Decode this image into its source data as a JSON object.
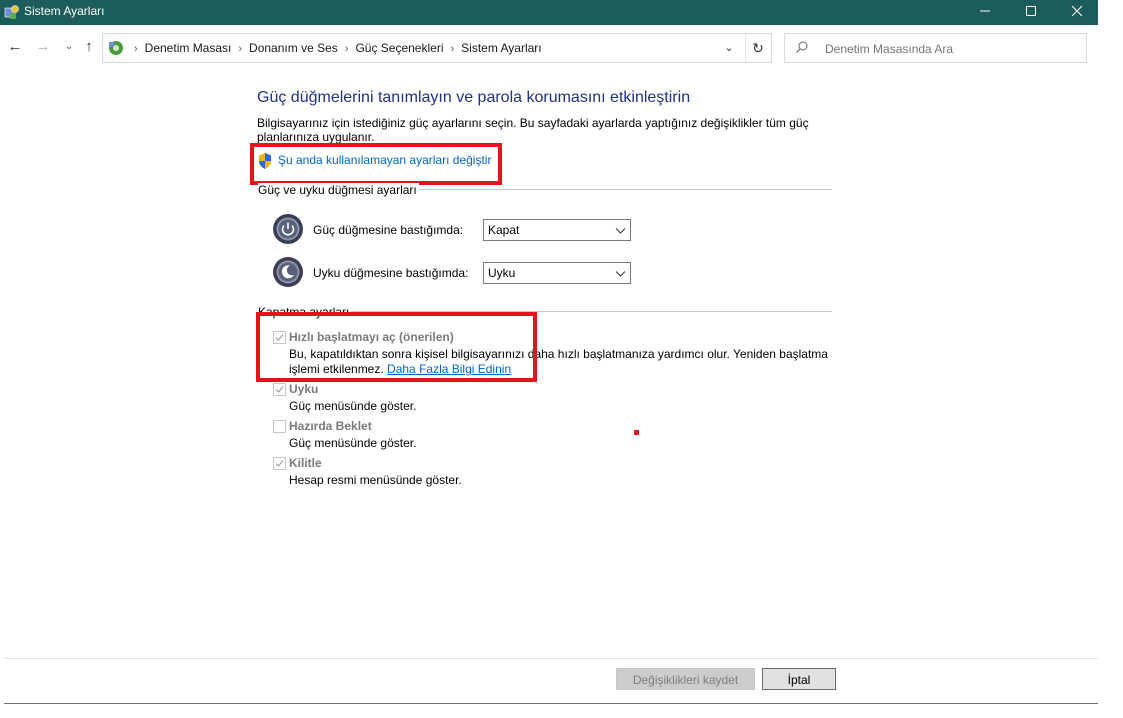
{
  "window": {
    "title": "Sistem Ayarları",
    "controls": [
      "minimize-icon",
      "maximize-icon",
      "close-icon"
    ]
  },
  "address_bar": {
    "breadcrumbs": [
      "Denetim Masası",
      "Donanım ve Ses",
      "Güç Seçenekleri",
      "Sistem Ayarları"
    ]
  },
  "search": {
    "placeholder": "Denetim Masasında Ara"
  },
  "main": {
    "title": "Güç düğmelerini tanımlayın ve parola korumasını etkinleştirin",
    "description": "Bilgisayarınız için istediğiniz güç ayarlarını seçin. Bu sayfadaki ayarlarda yaptığınız değişiklikler tüm güç planlarınıza uygulanır.",
    "change_settings_link": "Şu anda kullanılamayan ayarları değiştir",
    "power_group": {
      "header": "Güç ve uyku düğmesi ayarları",
      "rows": [
        {
          "label": "Güç düğmesine bastığımda:",
          "value": "Kapat",
          "icon": "power-button-icon"
        },
        {
          "label": "Uyku düğmesine bastığımda:",
          "value": "Uyku",
          "icon": "sleep-button-icon"
        }
      ]
    },
    "shutdown_group": {
      "header": "Kapatma ayarları",
      "options": [
        {
          "label": "Hızlı başlatmayı aç (önerilen)",
          "checked": true,
          "desc": "Bu, kapatıldıktan sonra kişisel bilgisayarınızı daha hızlı başlatmanıza yardımcı olur. Yeniden başlatma işlemi etkilenmez.",
          "link": "Daha Fazla Bilgi Edinin"
        },
        {
          "label": "Uyku",
          "checked": true,
          "desc": "Güç menüsünde göster."
        },
        {
          "label": "Hazırda Beklet",
          "checked": false,
          "desc": "Güç menüsünde göster."
        },
        {
          "label": "Kilitle",
          "checked": true,
          "desc": "Hesap resmi menüsünde göster."
        }
      ]
    }
  },
  "footer": {
    "save_label": "Değişiklikleri kaydet",
    "cancel_label": "İptal"
  },
  "colors": {
    "titlebar": "#1c5c5a",
    "heading": "#1e3287",
    "link": "#0066cc",
    "annotation_red": "#e3141b"
  }
}
